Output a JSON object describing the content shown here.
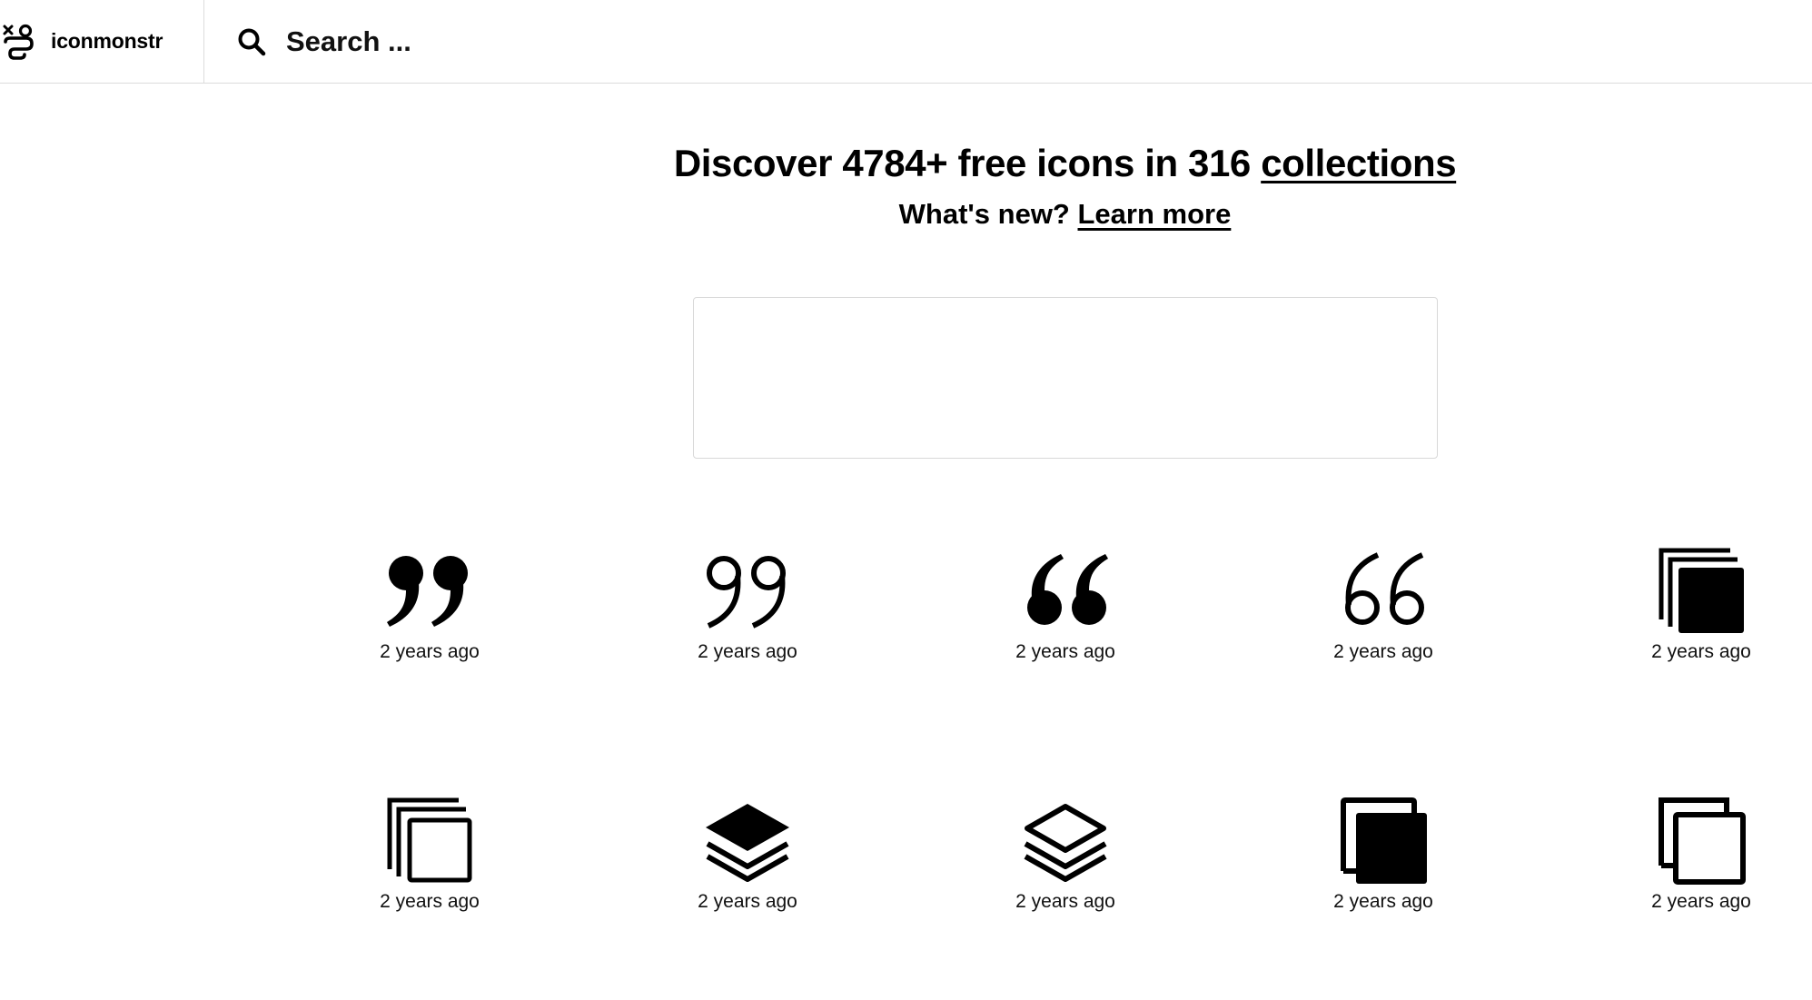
{
  "header": {
    "brand_name": "iconmonstr",
    "logo_icon": "iconmonstr-logo-icon",
    "search_icon": "magnifier-icon",
    "search_placeholder": "Search ..."
  },
  "hero": {
    "headline_prefix": "Discover 4784+ free icons in 316",
    "headline_link": "collections",
    "subline_prefix": "What's new?",
    "subline_link": "Learn more"
  },
  "icons": [
    {
      "icon": "quote-right-filled-icon",
      "age": "2 years ago"
    },
    {
      "icon": "quote-right-outline-icon",
      "age": "2 years ago"
    },
    {
      "icon": "quote-left-filled-icon",
      "age": "2 years ago"
    },
    {
      "icon": "quote-left-outline-icon",
      "age": "2 years ago"
    },
    {
      "icon": "stacked-squares-filled-icon",
      "age": "2 years ago"
    },
    {
      "icon": "stacked-squares-outline-icon",
      "age": "2 years ago"
    },
    {
      "icon": "layers-filled-icon",
      "age": "2 years ago"
    },
    {
      "icon": "layers-outline-icon",
      "age": "2 years ago"
    },
    {
      "icon": "copy-filled-icon",
      "age": "2 years ago"
    },
    {
      "icon": "copy-outline-icon",
      "age": "2 years ago"
    }
  ]
}
